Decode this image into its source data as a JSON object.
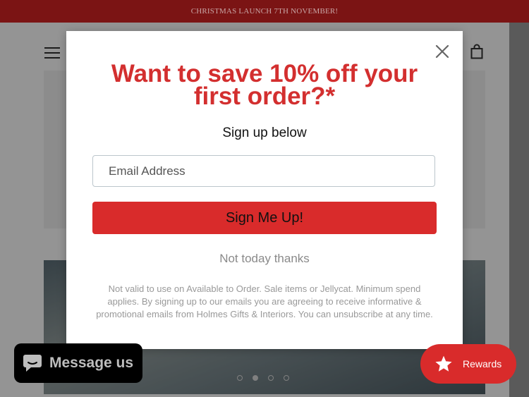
{
  "announcement": {
    "text": "CHRISTMAS LAUNCH 7TH NOVEMBER!"
  },
  "header": {
    "menu_icon": "hamburger-menu-icon",
    "cart_icon": "shopping-bag-icon"
  },
  "carousel": {
    "slide_count": 4,
    "active_index": 1
  },
  "popup": {
    "headline": "Want to save 10% off your first order?*",
    "subheading": "Sign up below",
    "email_placeholder": "Email Address",
    "submit_label": "Sign Me Up!",
    "decline_label": "Not today thanks",
    "fine_print": "Not valid to use on Available to Order. Sale items or Jellycat. Minimum spend applies. By signing up to our emails you are agreeing to receive informative & promotional emails from Holmes Gifts & Interiors. You can unsubscribe at any time.",
    "close_icon": "close-icon"
  },
  "chat_widget": {
    "label": "Message us",
    "icon": "chat-bubble-icon"
  },
  "rewards": {
    "label": "Rewards",
    "icon": "star-icon"
  },
  "colors": {
    "brand_red": "#d92b2b",
    "headline_red": "#d32f2f",
    "announcement_bg": "#7b1414"
  }
}
